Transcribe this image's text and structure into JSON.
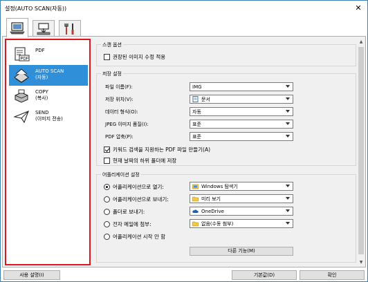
{
  "window": {
    "title": "설정(AUTO SCAN(자동))",
    "close_glyph": "✕"
  },
  "tabs": [
    {
      "icon": "computer-scan-icon"
    },
    {
      "icon": "scanner-panel-icon"
    },
    {
      "icon": "tools-icon"
    }
  ],
  "sidebar": {
    "items": [
      {
        "label": "PDF",
        "sublabel": "",
        "icon": "pdf-icon",
        "selected": false
      },
      {
        "label": "AUTO SCAN",
        "sublabel": "(자동)",
        "icon": "auto-scan-icon",
        "selected": true
      },
      {
        "label": "COPY",
        "sublabel": "(복사)",
        "icon": "copy-printer-icon",
        "selected": false
      },
      {
        "label": "SEND",
        "sublabel": "(이미지 전송)",
        "icon": "send-icon",
        "selected": false
      }
    ]
  },
  "scan_options": {
    "title": "스캔 옵션",
    "apply_image_correction": {
      "label": "권장된 이미지 수정 적용",
      "checked": false
    }
  },
  "save_settings": {
    "title": "저장 설정",
    "file_name": {
      "label": "파일 이름(F):",
      "value": "IMG"
    },
    "save_in": {
      "label": "저장 위치(V):",
      "value": "문서"
    },
    "data_format": {
      "label": "데이터 형식(O):",
      "value": "자동"
    },
    "jpeg_quality": {
      "label": "JPEG 이미지 품질(I):",
      "value": "표준"
    },
    "pdf_compression": {
      "label": "PDF 압축(P):",
      "value": "표준"
    },
    "keyword_pdf": {
      "label": "키워드 검색을 지원하는 PDF 파일 만들기(A)",
      "checked": true
    },
    "date_subfolder": {
      "label": "현재 날짜의 하위 폴더에 저장",
      "checked": false
    }
  },
  "app_settings": {
    "title": "어플리케이션 설정",
    "options": [
      {
        "label": "어플리케이션으로 열기:",
        "value": "Windows 탐색기",
        "selected": true,
        "icon": "folder-window-icon"
      },
      {
        "label": "어플리케이션으로 보내기:",
        "value": "미리 보기",
        "selected": false,
        "icon": "folder-icon"
      },
      {
        "label": "폴더로 보내기:",
        "value": "OneDrive",
        "selected": false,
        "icon": "cloud-icon"
      },
      {
        "label": "전자 메일에 첨부:",
        "value": "없음(수동 첨부)",
        "selected": false,
        "icon": "folder-icon"
      },
      {
        "label": "어플리케이션 시작 안 함",
        "value": "",
        "selected": false,
        "icon": ""
      }
    ],
    "more_functions_button": "다른 기능(M)"
  },
  "footer": {
    "instructions_button": "사용 설명(I)",
    "defaults_button": "기본값(D)",
    "ok_button": "확인"
  },
  "colors": {
    "selected_item": "#2f8fd8",
    "highlight_border": "#e0141e",
    "window_border": "#3c7fb1"
  }
}
